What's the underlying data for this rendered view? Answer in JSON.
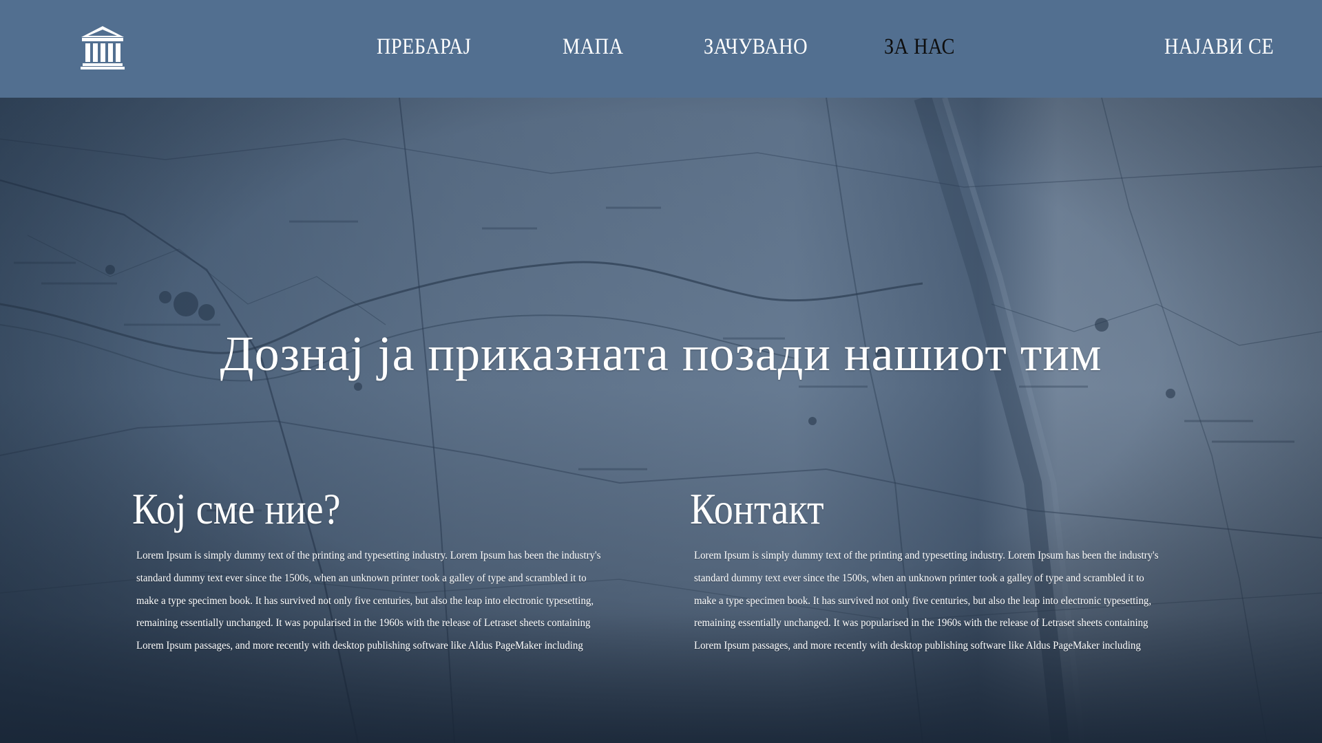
{
  "header": {
    "logo_icon": "museum-building-icon",
    "nav": {
      "search": "ПРЕБАРАЈ",
      "map": "МАПА",
      "saved": "ЗАЧУВАНО",
      "about": "ЗА НАС",
      "login": "НАЈАВИ СЕ"
    },
    "active_item": "about",
    "background_color": "#526f90",
    "active_color": "#0e0e0e"
  },
  "hero": {
    "background": "vintage-map-photo",
    "title": "Дознај ја приказната позади нашиот тим"
  },
  "sections": {
    "about": {
      "heading": "Кој сме ние?",
      "body": "Lorem Ipsum is simply dummy text of the printing and typesetting industry. Lorem Ipsum has been the industry's standard dummy text ever since the 1500s, when an unknown printer took a galley of type and scrambled it to make a type specimen book. It has survived not only five centuries, but also the leap into electronic typesetting, remaining essentially unchanged. It was popularised in the 1960s with the release of Letraset sheets containing Lorem Ipsum passages, and more recently with desktop publishing software like Aldus PageMaker including"
    },
    "contact": {
      "heading": "Контакт",
      "body": "Lorem Ipsum is simply dummy text of the printing and typesetting industry. Lorem Ipsum has been the industry's standard dummy text ever since the 1500s, when an unknown printer took a galley of type and scrambled it to make a type specimen book. It has survived not only five centuries, but also the leap into electronic typesetting, remaining essentially unchanged. It was popularised in the 1960s with the release of Letraset sheets containing Lorem Ipsum passages, and more recently with desktop publishing software like Aldus PageMaker including"
    }
  }
}
